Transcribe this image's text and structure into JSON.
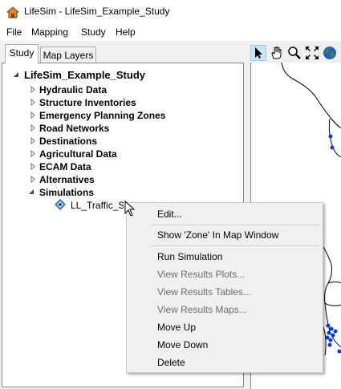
{
  "window": {
    "title": "LifeSim - LifeSim_Example_Study"
  },
  "menu": [
    "File",
    "Mapping",
    "Study",
    "Help"
  ],
  "tabs": [
    {
      "label": "Study",
      "active": true
    },
    {
      "label": "Map Layers",
      "active": false
    }
  ],
  "toolbar": [
    "select-arrow-icon",
    "pan-hand-icon",
    "zoom-icon",
    "full-extent-icon",
    "globe-icon"
  ],
  "tree": {
    "root": "LifeSim_Example_Study",
    "items": [
      {
        "label": "Hydraulic Data",
        "expanded": false
      },
      {
        "label": "Structure Inventories",
        "expanded": false
      },
      {
        "label": "Emergency Planning Zones",
        "expanded": false
      },
      {
        "label": "Road Networks",
        "expanded": false
      },
      {
        "label": "Destinations",
        "expanded": false
      },
      {
        "label": "Agricultural Data",
        "expanded": false
      },
      {
        "label": "ECAM Data",
        "expanded": false
      },
      {
        "label": "Alternatives",
        "expanded": false
      },
      {
        "label": "Simulations",
        "expanded": true
      }
    ],
    "child": "LL_Traffic_SIM"
  },
  "context_menu": [
    {
      "label": "Edit...",
      "enabled": true
    },
    {
      "label": "Show 'Zone' In Map Window",
      "enabled": true
    },
    {
      "label": "Run Simulation",
      "enabled": true
    },
    {
      "label": "View Results Plots...",
      "enabled": false
    },
    {
      "label": "View Results Tables...",
      "enabled": false
    },
    {
      "label": "View Results Maps...",
      "enabled": false
    },
    {
      "label": "Move Up",
      "enabled": true
    },
    {
      "label": "Move Down",
      "enabled": true
    },
    {
      "label": "Delete",
      "enabled": true
    }
  ],
  "colors": {
    "accent": "#1f4e9c",
    "map_points": "#0b3bd6",
    "disabled_text": "#6d6d6d"
  }
}
